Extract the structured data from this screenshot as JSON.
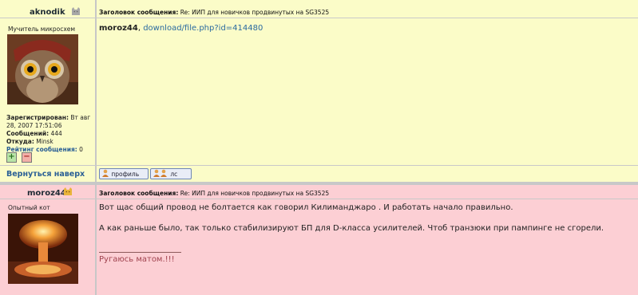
{
  "posts": [
    {
      "author": "aknodik",
      "rank": "Мучитель микросхем",
      "subject_label": "Заголовок сообщения:",
      "subject": "Re: ИИП для новичков продвинутых на SG3525",
      "reply_to": "moroz44",
      "reply_sep": ",",
      "link": "download/file.php?id=414480",
      "registered_label": "Зарегистрирован:",
      "registered_value1": "Вт авг",
      "registered_value2": "28, 2007 17:51:06",
      "messages_label": "Сообщений:",
      "messages_value": "444",
      "from_label": "Откуда:",
      "from_value": "Minsk",
      "rating_label": "Рейтинг сообщения:",
      "rating_value": "0",
      "plus": "+",
      "minus": "−",
      "back_to_top": "Вернуться наверх",
      "profile_btn": "профиль",
      "pm_btn": "лс",
      "avatar_icon": "owl-avatar"
    },
    {
      "author": "moroz44",
      "rank": "Опытный кот",
      "subject_label": "Заголовок сообщения:",
      "subject": "Re: ИИП для новичков продвинутых на SG3525",
      "line1": "Вот щас общий провод не болтается как говорил Килиманджаро . И работать начало правильно.",
      "line2": "А как раньше было, так только стабилизируют БП для D-класса усилителей. Чтоб транзюки при пампинге не сгорели.",
      "signature": "Ругаюсь матом.!!!",
      "avatar_icon": "nuclear-explosion-avatar"
    }
  ],
  "colors": {
    "post1_bg": "#fbfcc8",
    "post2_bg": "#fccfd4",
    "link": "#2a6aa0",
    "signature": "#a0434f"
  }
}
